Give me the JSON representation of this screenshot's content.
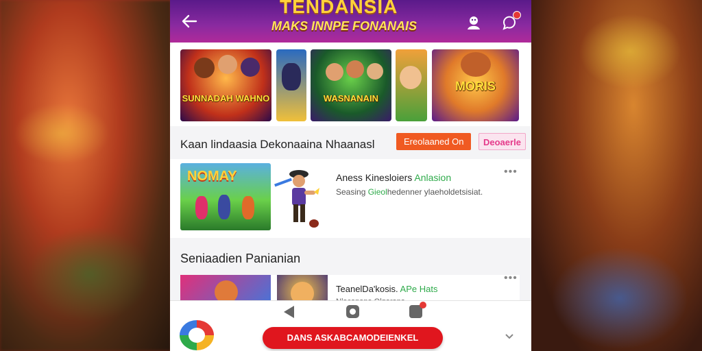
{
  "header": {
    "banner_title": "TENDANSIA",
    "banner_subtitle": "MAKS INNPE FONANAIS",
    "back_icon": "arrow-left-icon",
    "profile_icon": "user-icon",
    "chat_icon": "chat-bubble-icon"
  },
  "thumbnails": [
    {
      "label": "SUNNADAH WAHNO"
    },
    {
      "label": ""
    },
    {
      "label": "WASNANAIN"
    },
    {
      "label": ""
    },
    {
      "label": "MORIS"
    }
  ],
  "filter_row": {
    "title": "Kaan lindaasia Dekonaaina Nhaanasl",
    "chip_primary": "Ereolaaned On",
    "chip_secondary": "Deoaerle"
  },
  "featured": {
    "image_label": "NOMAY",
    "name": "Aness Kinesloiers",
    "name_accent": "Anlasion",
    "desc_prefix": "Seasing",
    "desc_accent": "Gieol",
    "desc_rest": "hedenner ylaeholdetsisiat.",
    "more_label": "•••"
  },
  "section2": {
    "title": "Seniaadien Panianian",
    "row": {
      "name": "TeanelDa'kosis.",
      "name_accent": "APe Hats",
      "sub": "Nlacanana Olgarana",
      "more_label": "•••"
    }
  },
  "bottom": {
    "cta_label": "DANS ASKABCAMODEIENKEL",
    "chevron_icon": "chevron-down-icon"
  },
  "colors": {
    "accent_red": "#e0161e",
    "chip_orange": "#f05a22",
    "chip_pink_text": "#e53a8a",
    "green_text": "#2eaa4a",
    "header_purple": "#5a1a8a"
  }
}
